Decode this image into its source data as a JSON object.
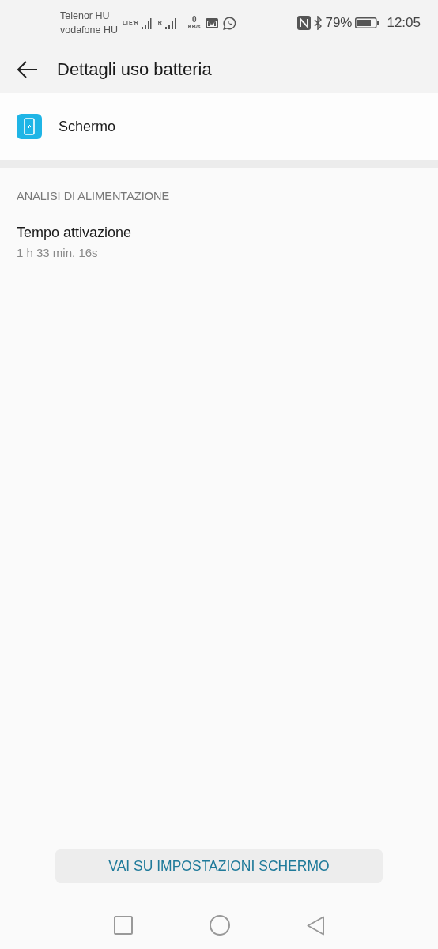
{
  "status_bar": {
    "carriers": [
      "Telenor HU",
      "vodafone HU"
    ],
    "network_type": "LTE⁺R",
    "roaming": "R",
    "data_rate": "0",
    "data_unit": "KB/s",
    "battery_percent": "79%",
    "time": "12:05"
  },
  "toolbar": {
    "title": "Dettagli uso batteria"
  },
  "app": {
    "name": "Schermo"
  },
  "section": {
    "header": "ANALISI DI ALIMENTAZIONE",
    "items": [
      {
        "title": "Tempo attivazione",
        "value": "1 h 33 min. 16s"
      }
    ]
  },
  "action_button": {
    "label": "VAI SU IMPOSTAZIONI SCHERMO"
  }
}
